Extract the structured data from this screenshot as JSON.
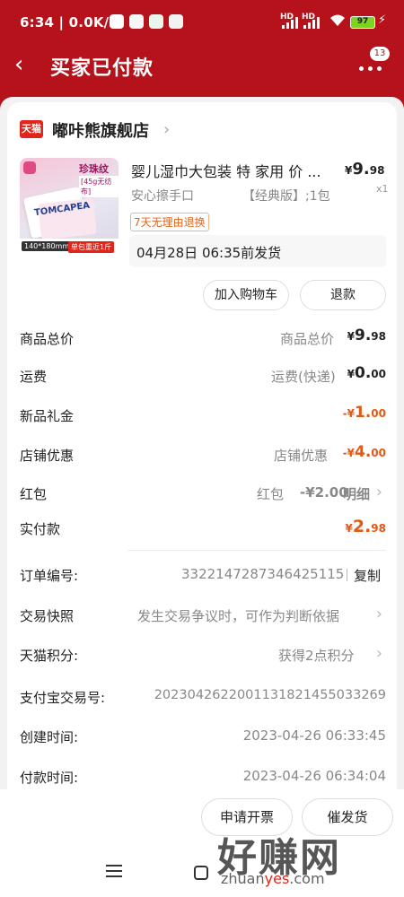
{
  "status_bar": {
    "time": "6:34",
    "speed": "0.0K/s",
    "network_1": "HD",
    "network_2": "HD",
    "battery": "97"
  },
  "header": {
    "title": "买家已付款",
    "more_badge": "13"
  },
  "store": {
    "platform_tag": "天猫",
    "name": "嘟咔熊旗舰店"
  },
  "product": {
    "title": "婴儿湿巾大包装 特 家用 价 ...",
    "price_currency": "¥",
    "price_int": "9.",
    "price_dec": "98",
    "quantity": "x1",
    "sku_left": "安心擦手口",
    "sku_right": "【经典版】;1包",
    "return_tag": "7天无理由退换",
    "ship_notice": "04月28日 06:35前发货",
    "thumb": {
      "title": "珍珠纹",
      "sub": "[45g无纺布]",
      "brand": "TOMCAPEA",
      "size": "140*180mm",
      "promo": "单包重近1斤"
    }
  },
  "actions": {
    "add_cart": "加入购物车",
    "refund": "退款",
    "invoice": "申请开票",
    "urge_ship": "催发货"
  },
  "fees": {
    "goods_total": {
      "label": "商品总价",
      "desc": "商品总价",
      "cur": "¥",
      "int": "9.",
      "dec": "98"
    },
    "shipping": {
      "label": "运费",
      "desc": "运费(快递)",
      "cur": "¥",
      "int": "0.",
      "dec": "00"
    },
    "gift": {
      "label": "新品礼金",
      "cur": "-¥",
      "int": "1.",
      "dec": "00"
    },
    "store_discount": {
      "label": "店铺优惠",
      "desc": "店铺优惠",
      "cur": "-¥",
      "int": "4.",
      "dec": "00"
    },
    "red_packet": {
      "label": "红包",
      "desc": "红包",
      "amount": "-¥2.00",
      "detail": "明细"
    },
    "paid": {
      "label": "实付款",
      "cur": "¥",
      "int": "2.",
      "dec": "98"
    }
  },
  "order": {
    "number_label": "订单编号:",
    "number": "3322147287346425115",
    "copy": "复制",
    "snapshot_label": "交易快照",
    "snapshot_desc": "发生交易争议时，可作为判断依据",
    "points_label": "天猫积分:",
    "points_value": "获得2点积分",
    "alipay_label": "支付宝交易号:",
    "alipay_value": "2023042622001131821455033269",
    "created_label": "创建时间:",
    "created_value": "2023-04-26 06:33:45",
    "paid_label": "付款时间:",
    "paid_value": "2023-04-26 06:34:04"
  },
  "watermark": {
    "text": "好赚网",
    "url_a": "zhuan",
    "url_b": "yes",
    "url_c": ".com"
  }
}
